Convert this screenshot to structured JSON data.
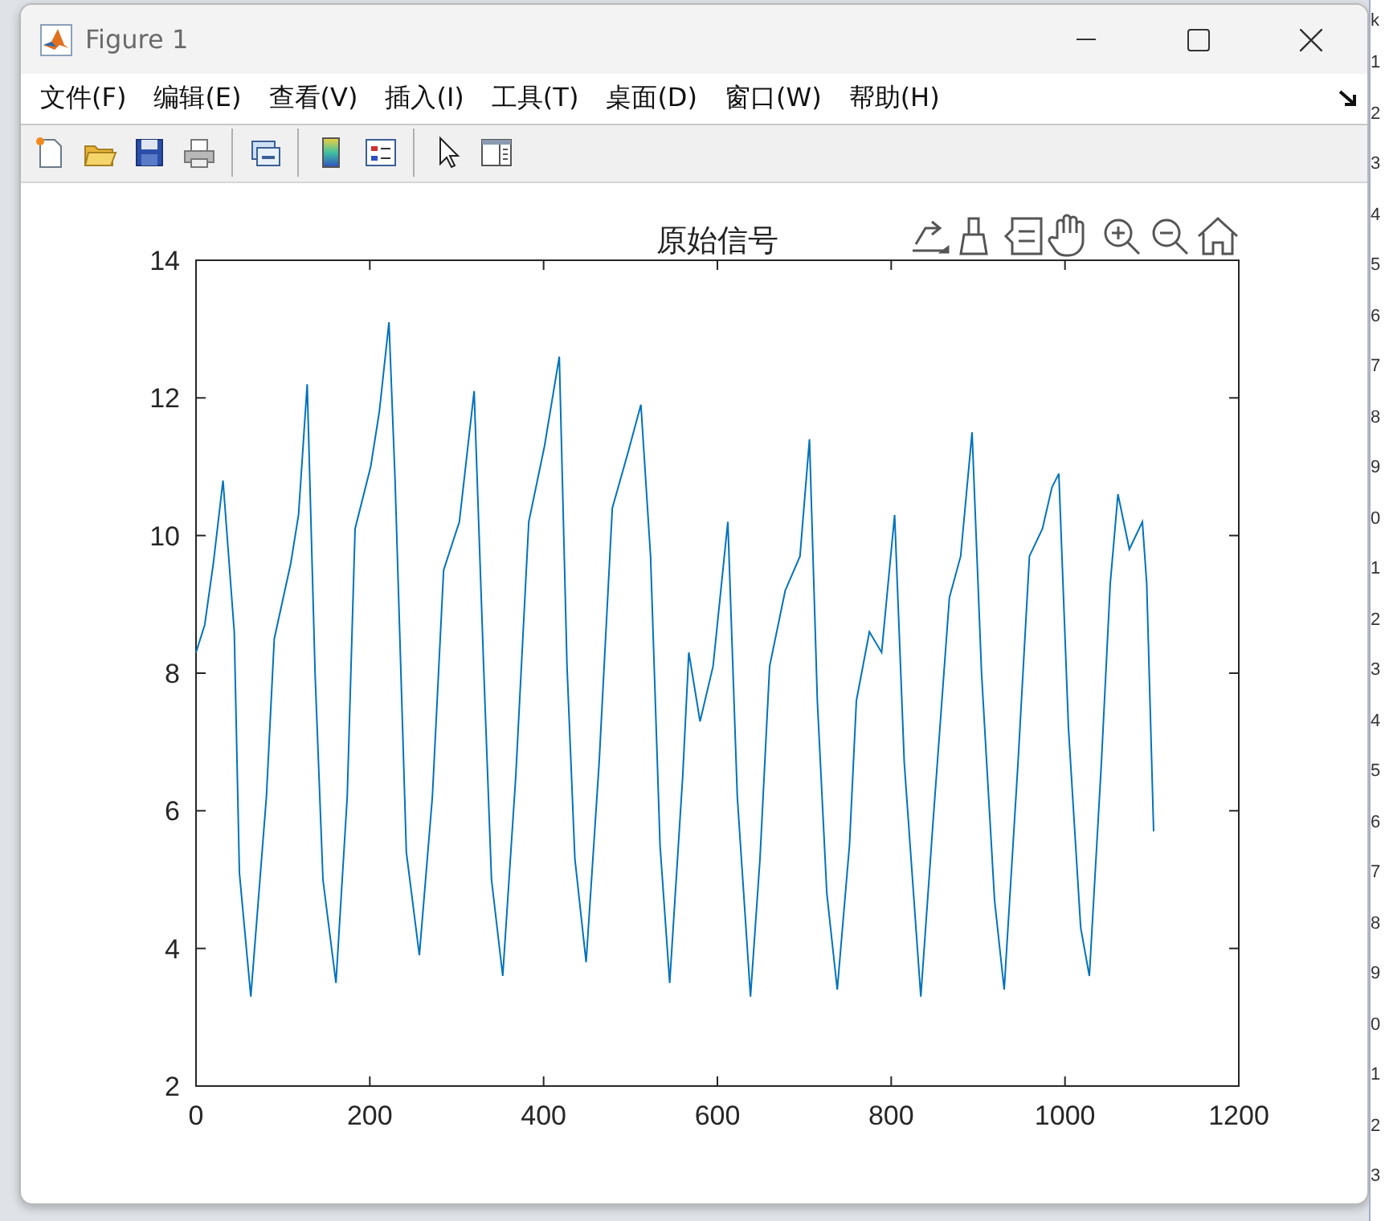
{
  "window": {
    "title": "Figure 1"
  },
  "menu": [
    "文件(F)",
    "编辑(E)",
    "查看(V)",
    "插入(I)",
    "工具(T)",
    "桌面(D)",
    "窗口(W)",
    "帮助(H)"
  ],
  "figure": {
    "chart_data": {
      "type": "line",
      "title": "原始信号",
      "xlim": [
        0,
        1200
      ],
      "ylim": [
        2,
        14
      ],
      "xticks": [
        0,
        200,
        400,
        600,
        800,
        1000,
        1200
      ],
      "yticks": [
        2,
        4,
        6,
        8,
        10,
        12,
        14
      ],
      "x": [
        0,
        10,
        20,
        31,
        44,
        50,
        63,
        81,
        90,
        109,
        118,
        128,
        137,
        146,
        161,
        174,
        183,
        201,
        211,
        222,
        229,
        242,
        257,
        272,
        285,
        303,
        320,
        331,
        340,
        353,
        368,
        383,
        401,
        418,
        427,
        436,
        449,
        464,
        479,
        497,
        512,
        523,
        534,
        545,
        560,
        567,
        580,
        595,
        612,
        623,
        638,
        649,
        660,
        678,
        695,
        706,
        715,
        726,
        738,
        752,
        760,
        775,
        789,
        804,
        815,
        834,
        848,
        867,
        880,
        893,
        904,
        919,
        930,
        946,
        959,
        974,
        985,
        993,
        1004,
        1018,
        1028,
        1042,
        1052,
        1061,
        1074,
        1089,
        1094,
        1102
      ],
      "series": [
        {
          "color": "#0072bd",
          "values": [
            8.3,
            8.7,
            9.6,
            10.8,
            8.6,
            5.1,
            3.3,
            6.2,
            8.5,
            9.6,
            10.3,
            12.2,
            8.0,
            5.0,
            3.5,
            6.2,
            10.1,
            11.0,
            11.8,
            13.1,
            10.8,
            5.4,
            3.9,
            6.2,
            9.5,
            10.2,
            12.1,
            8.1,
            5.0,
            3.6,
            6.5,
            10.2,
            11.3,
            12.6,
            8.1,
            5.3,
            3.8,
            6.7,
            10.4,
            11.2,
            11.9,
            9.7,
            5.5,
            3.5,
            6.5,
            8.3,
            7.3,
            8.1,
            10.2,
            6.2,
            3.3,
            5.3,
            8.1,
            9.2,
            9.7,
            11.4,
            7.6,
            4.8,
            3.4,
            5.5,
            7.6,
            8.6,
            8.3,
            10.3,
            6.7,
            3.3,
            5.8,
            9.1,
            9.7,
            11.5,
            8.0,
            4.7,
            3.4,
            6.7,
            9.7,
            10.1,
            10.7,
            10.9,
            7.2,
            4.3,
            3.6,
            6.7,
            9.3,
            10.6,
            9.8,
            10.2,
            9.3,
            5.7
          ]
        }
      ]
    }
  },
  "background_sheet": {
    "header": "k",
    "row_labels": [
      "1",
      "2",
      "3",
      "4",
      "5",
      "6",
      "7",
      "8",
      "9",
      "0",
      "1",
      "2",
      "3",
      "4",
      "5",
      "6",
      "7",
      "8",
      "9",
      "0",
      "1",
      "2",
      "3"
    ]
  }
}
